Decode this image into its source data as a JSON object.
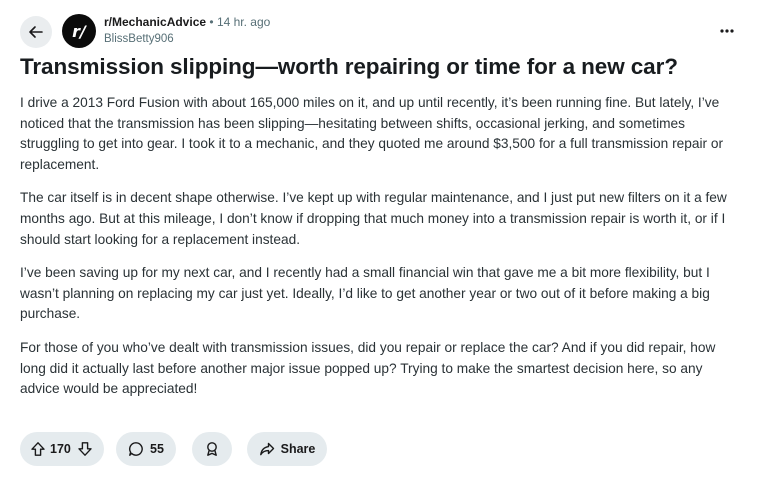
{
  "post": {
    "subreddit": "r/MechanicAdvice",
    "separator": "•",
    "time": "14 hr. ago",
    "author": "BlissBetty906",
    "avatar_text": "r/",
    "title": "Transmission slipping—worth repairing or time for a new car?",
    "paragraphs": [
      "I drive a 2013 Ford Fusion with about 165,000 miles on it, and up until recently, it’s been running fine. But lately, I’ve noticed that the transmission has been slipping—hesitating between shifts, occasional jerking, and sometimes struggling to get into gear. I took it to a mechanic, and they quoted me around $3,500 for a full transmission repair or replacement.",
      "The car itself is in decent shape otherwise. I’ve kept up with regular maintenance, and I just put new filters on it a few months ago. But at this mileage, I don’t know if dropping that much money into a transmission repair is worth it, or if I should start looking for a replacement instead.",
      "I’ve been saving up for my next car, and I recently had a small financial win that gave me a bit more flexibility, but I wasn’t planning on replacing my car just yet. Ideally, I’d like to get another year or two out of it before making a big purchase.",
      "For those of you who’ve dealt with transmission issues, did you repair or replace the car? And if you did repair, how long did it actually last before another major issue popped up? Trying to make the smartest decision here, so any advice would be appreciated!"
    ]
  },
  "actions": {
    "vote_count": "170",
    "comment_count": "55",
    "share_label": "Share"
  },
  "icons": {
    "back": "arrow-left-icon",
    "more": "more-horizontal-icon",
    "upvote": "arrow-up-icon",
    "downvote": "arrow-down-icon",
    "comment": "comment-bubble-icon",
    "award": "award-icon",
    "share": "share-arrow-icon"
  }
}
